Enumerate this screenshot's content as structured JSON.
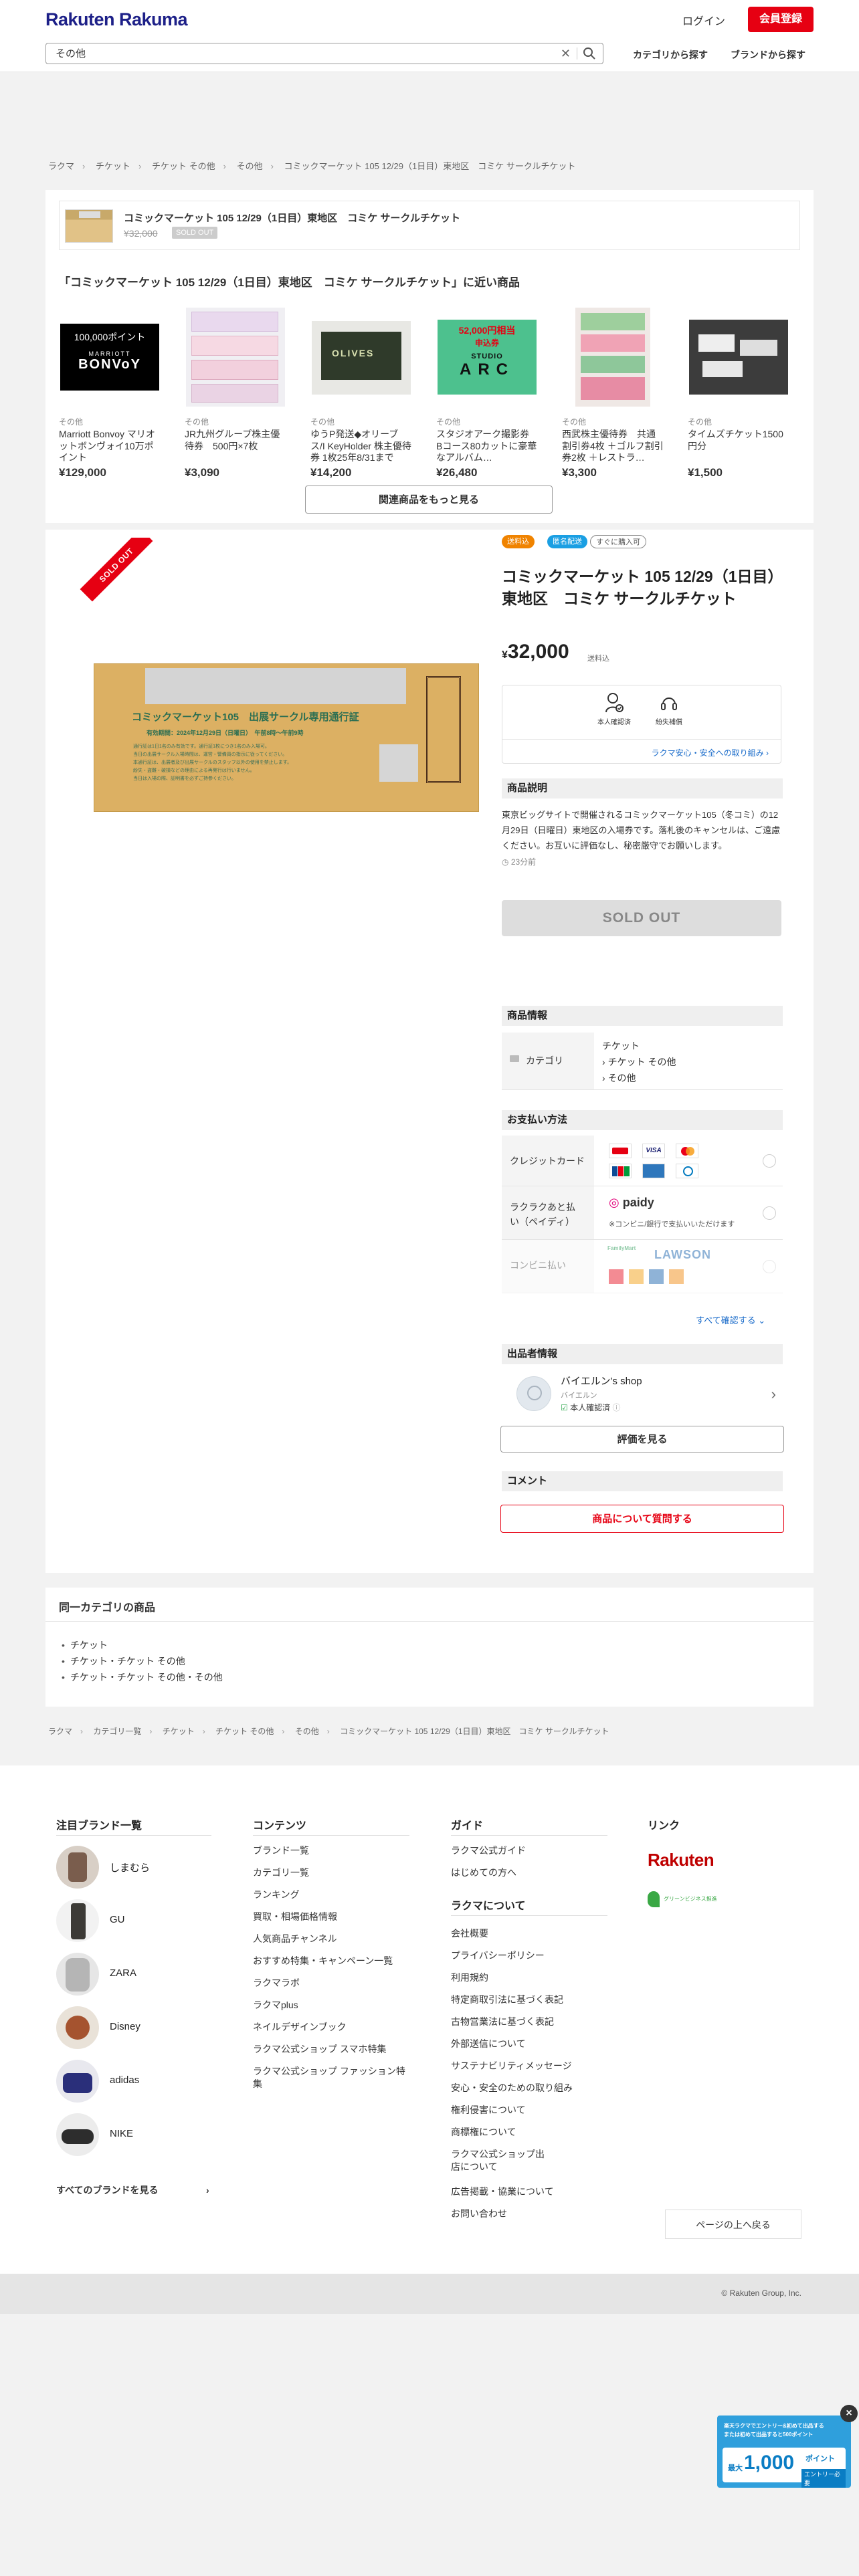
{
  "header": {
    "logo": "Rakuten Rakuma",
    "login": "ログイン",
    "register": "会員登録",
    "search_value": "その他",
    "nav_category": "カテゴリから探す",
    "nav_brand": "ブランドから探す"
  },
  "breadcrumb_top": [
    "ラクマ",
    "チケット",
    "チケット その他",
    "その他",
    "コミックマーケット 105 12/29（1日目）東地区　コミケ サークルチケット"
  ],
  "mini_card": {
    "title": "コミックマーケット 105 12/29（1日目）東地区　コミケ サークルチケット",
    "price": "¥32,000",
    "status": "SOLD OUT"
  },
  "related": {
    "heading": "「コミックマーケット 105 12/29（1日目）東地区　コミケ サークルチケット」に近い商品",
    "items": [
      {
        "category": "その他",
        "name": "Marriott Bonvoy マリオットボンヴォイ10万ポイント",
        "price": "¥129,000",
        "img_top": "100,000ポイント",
        "img_mid": "MARRIOTT",
        "img_bot": "BONVoY"
      },
      {
        "category": "その他",
        "name": "JR九州グループ株主優待券　500円×7枚",
        "price": "¥3,090"
      },
      {
        "category": "その他",
        "name": "ゆうP発送◆オリーブス/I KeyHolder 株主優待券 1枚25年8/31まで",
        "price": "¥14,200",
        "img_text": "OLIVES"
      },
      {
        "category": "その他",
        "name": "スタジオアーク撮影券 Bコース80カットに豪華なアルバム…",
        "price": "¥26,480",
        "img_top": "52,000円相当",
        "img_sub": "申込券",
        "img_mid": "STUDIO",
        "img_bot": "ARC"
      },
      {
        "category": "その他",
        "name": "西武株主優待券　共通割引券4枚 ＋ゴルフ割引券2枚 ＋レストラ…",
        "price": "¥3,300"
      },
      {
        "category": "その他",
        "name": "タイムズチケット1500円分",
        "price": "¥1,500"
      }
    ],
    "more": "関連商品をもっと見る"
  },
  "product": {
    "sold_ribbon": "SOLD OUT",
    "badges": [
      "送料込",
      "匿名配送",
      "すぐに購入可"
    ],
    "title": "コミックマーケット 105 12/29（1日目）東地区　コミケ サークルチケット",
    "price_yen": "¥",
    "price": "32,000",
    "shipping": "送料込",
    "ticket_title": "コミックマーケット105　出展サークル専用通行証",
    "ticket_date": "有効期間：2024年12月29日（日曜日）　午前8時～午前9時",
    "ticket_lines": [
      "通行証は1日1名のみ有効です。通行証1枚につき1名のみ入場可。",
      "当日の出展サークル入場時間は、運営・警備員の指示に従ってください。",
      "本通行証は、出展者及び出展サークルのスタッフ以外の使用を禁止します。",
      "紛失・盗難・破損などの理由による再発行は行いません。",
      "当日は入場の際、証明書を必ずご持参ください。"
    ],
    "trust": {
      "identity": "本人確認済",
      "compensation": "紛失補償",
      "link": "ラクマ安心・安全への取り組み"
    },
    "desc_head": "商品説明",
    "description": "東京ビッグサイトで開催されるコミックマーケット105（冬コミ）の12月29日（日曜日）東地区の入場券です。落札後のキャンセルは、ご遠慮ください。お互いに評価なし、秘密厳守でお願いします。",
    "time": "23分前",
    "soldout_button": "SOLD OUT"
  },
  "product_info": {
    "heading": "商品情報",
    "category_label": "カテゴリ",
    "category_values": [
      "チケット",
      "チケット その他",
      "その他"
    ]
  },
  "payment": {
    "heading": "お支払い方法",
    "credit_label": "クレジットカード",
    "paidy_label": "ラクラクあと払い（ペイディ）",
    "paidy_logo": "paidy",
    "paidy_note": "※コンビニ/銀行で支払いいただけます",
    "conv_label": "コンビニ払い",
    "conv_logo": "LAWSON",
    "conv_logo_sub": "FamilyMart",
    "card_brands": [
      "VISA",
      "Mastercard",
      "JCB",
      "AMEX",
      "Diners"
    ],
    "see_all": "すべて確認する"
  },
  "seller": {
    "heading": "出品者情報",
    "name": "バイエルン's shop",
    "sub": "バイエルン",
    "verified": "本人確認済",
    "reviews_button": "評価を見る"
  },
  "comment": {
    "heading": "コメント",
    "ask_button": "商品について質問する"
  },
  "same_category": {
    "title": "同一カテゴリの商品",
    "items": [
      "チケット",
      "チケット・チケット その他",
      "チケット・チケット その他・その他"
    ]
  },
  "breadcrumb_bottom": [
    "ラクマ",
    "カテゴリ一覧",
    "チケット",
    "チケット その他",
    "その他",
    "コミックマーケット 105 12/29（1日目）東地区　コミケ サークルチケット"
  ],
  "footer": {
    "brands_title": "注目ブランド一覧",
    "brands": [
      "しまむら",
      "GU",
      "ZARA",
      "Disney",
      "adidas",
      "NIKE"
    ],
    "all_brands": "すべてのブランドを見る",
    "contents_title": "コンテンツ",
    "contents": [
      "ブランド一覧",
      "カテゴリ一覧",
      "ランキング",
      "買取・相場価格情報",
      "人気商品チャンネル",
      "おすすめ特集・キャンペーン一覧",
      "ラクマラボ",
      "ラクマplus",
      "ネイルデザインブック",
      "ラクマ公式ショップ スマホ特集",
      "ラクマ公式ショップ ファッション特集"
    ],
    "guide_title": "ガイド",
    "guide": [
      "ラクマ公式ガイド",
      "はじめての方へ"
    ],
    "about_title": "ラクマについて",
    "about": [
      "会社概要",
      "プライバシーポリシー",
      "利用規約",
      "特定商取引法に基づく表記",
      "古物営業法に基づく表記",
      "外部送信について",
      "サステナビリティメッセージ",
      "安心・安全のための取り組み",
      "権利侵害について",
      "商標権について",
      "ラクマ公式ショップ出店について",
      "広告掲載・協業について",
      "お問い合わせ"
    ],
    "link_title": "リンク",
    "rakuten_logo": "Rakuten",
    "green_badge": "グリーンビジネス推進",
    "page_top": "ページの上へ戻る",
    "copyright": "© Rakuten Group, Inc."
  },
  "float_banner": {
    "line1": "楽天ラクマでエントリー&初めて出品する",
    "line2": "または初めて出品すると500ポイント",
    "big": "1,000",
    "unit": "ポイント",
    "prefix": "最大",
    "cta": "エントリー必要"
  }
}
